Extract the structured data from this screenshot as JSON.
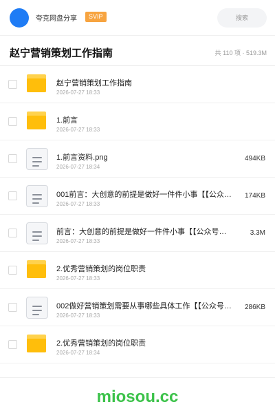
{
  "header": {
    "user_name": "夸克网盘分享",
    "badge": "SVIP",
    "search_placeholder": "搜索"
  },
  "folder": {
    "title": "赵宁营销策划工作指南",
    "summary": "共 110 项 · 519.3M"
  },
  "files": [
    {
      "type": "folder",
      "name": "赵宁营销策划工作指南",
      "date": "2026-07-27 18:33",
      "size": ""
    },
    {
      "type": "folder",
      "name": "1.前言",
      "date": "2026-07-27 18:33",
      "size": ""
    },
    {
      "type": "doc",
      "name": "1.前言资料.png",
      "date": "2026-07-27 18:34",
      "size": "494KB"
    },
    {
      "type": "doc",
      "name": "001前言：大创意的前提是做好一件件小事【【公众号：密知",
      "date": "2026-07-27 18:33",
      "size": "174KB"
    },
    {
      "type": "doc",
      "name": "前言：大创意的前提是做好一件件小事【【公众号：密知",
      "date": "2026-07-27 18:33",
      "size": "3.3M"
    },
    {
      "type": "folder",
      "name": "2.优秀营销策划的岗位职责",
      "date": "2026-07-27 18:33",
      "size": ""
    },
    {
      "type": "doc",
      "name": "002做好营销策划需要从事哪些具体工作【【公众号：密知",
      "date": "2026-07-27 18:33",
      "size": "286KB"
    },
    {
      "type": "folder",
      "name": "2.优秀营销策划的岗位职责",
      "date": "2026-07-27 18:34",
      "size": ""
    }
  ],
  "watermark": "miosou.cc",
  "colors": {
    "avatar": "#1f7cf5",
    "badge": "#f7a440",
    "folder": "#ffbe0b",
    "watermark": "#3cc24a"
  }
}
